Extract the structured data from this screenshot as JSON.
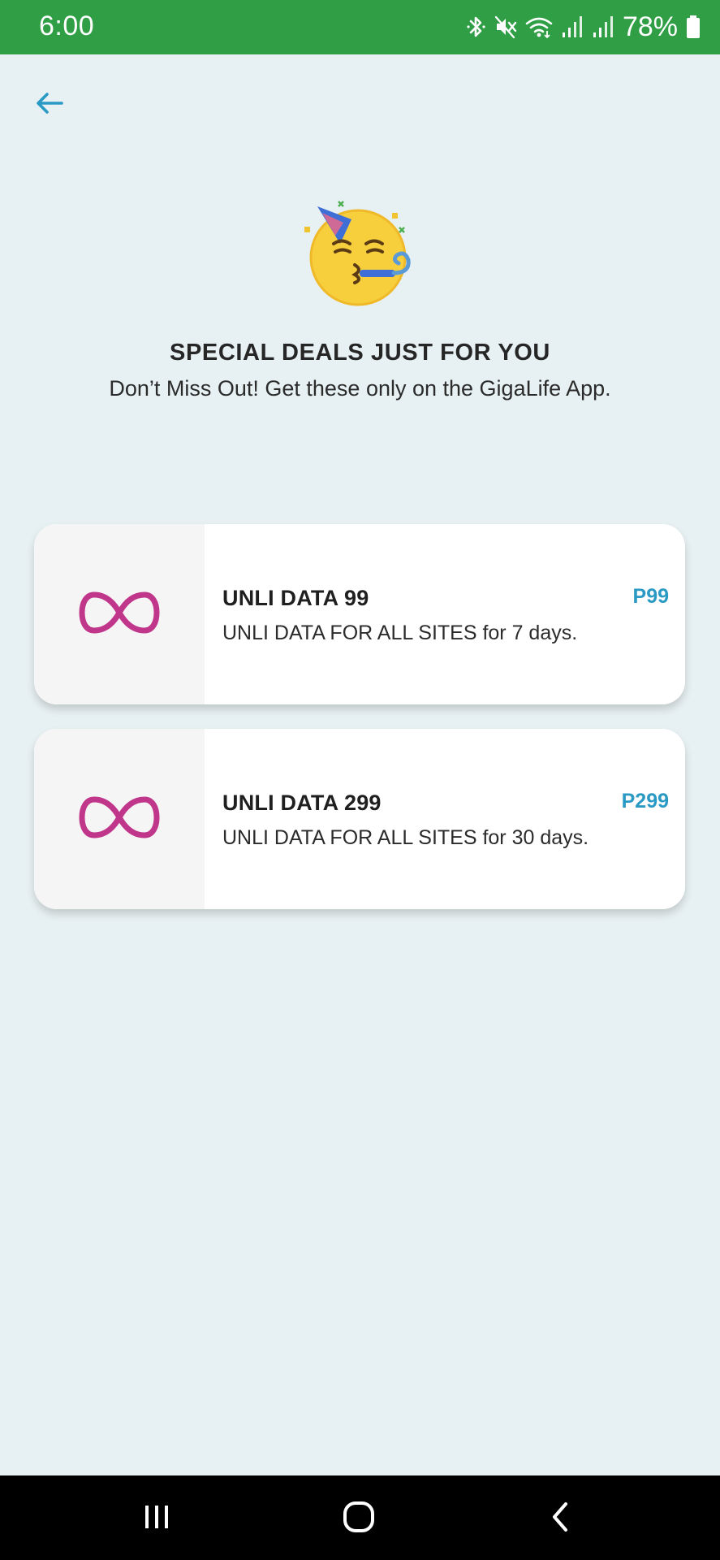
{
  "status_bar": {
    "time": "6:00",
    "battery_percent": "78%",
    "background_color": "#2f9e44",
    "icons": [
      "bluetooth-icon",
      "mute-icon",
      "wifi-icon",
      "signal-icon",
      "signal-icon",
      "battery-icon"
    ]
  },
  "header": {
    "back_icon": "arrow-left-icon",
    "accent_color": "#2a9ac5"
  },
  "hero": {
    "emoji": "partying-face-icon",
    "title": "SPECIAL DEALS JUST FOR YOU",
    "subtitle": "Don’t Miss Out! Get these only on the GigaLife App."
  },
  "deals": [
    {
      "icon": "infinity-icon",
      "title": "UNLI DATA 99",
      "description": "UNLI DATA FOR ALL SITES for 7 days.",
      "price": "P99"
    },
    {
      "icon": "infinity-icon",
      "title": "UNLI DATA 299",
      "description": "UNLI DATA FOR ALL SITES for 30 days.",
      "price": "P299"
    }
  ],
  "nav_bar": {
    "buttons": [
      "recents-icon",
      "home-icon",
      "back-chevron-icon"
    ]
  }
}
